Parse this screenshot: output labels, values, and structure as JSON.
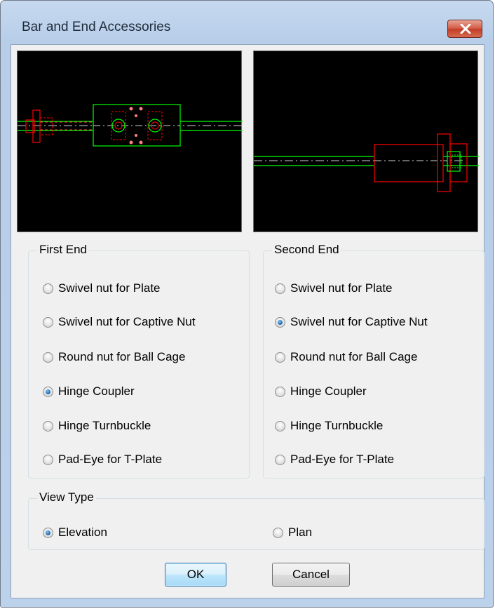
{
  "window": {
    "title": "Bar and End Accessories"
  },
  "first_end": {
    "legend": "First End",
    "options": [
      {
        "label": "Swivel nut for Plate",
        "checked": false
      },
      {
        "label": "Swivel nut for Captive Nut",
        "checked": false
      },
      {
        "label": "Round nut for Ball Cage",
        "checked": false
      },
      {
        "label": "Hinge Coupler",
        "checked": true
      },
      {
        "label": "Hinge Turnbuckle",
        "checked": false
      },
      {
        "label": "Pad-Eye for T-Plate",
        "checked": false
      }
    ]
  },
  "second_end": {
    "legend": "Second End",
    "options": [
      {
        "label": "Swivel nut for Plate",
        "checked": false
      },
      {
        "label": "Swivel nut for Captive Nut",
        "checked": true
      },
      {
        "label": "Round nut for Ball Cage",
        "checked": false
      },
      {
        "label": "Hinge Coupler",
        "checked": false
      },
      {
        "label": "Hinge Turnbuckle",
        "checked": false
      },
      {
        "label": "Pad-Eye for T-Plate",
        "checked": false
      }
    ]
  },
  "view_type": {
    "legend": "View Type",
    "options": [
      {
        "label": "Elevation",
        "checked": true
      },
      {
        "label": "Plan",
        "checked": false
      }
    ]
  },
  "buttons": {
    "ok": "OK",
    "cancel": "Cancel"
  },
  "colors": {
    "preview_bg": "#000000",
    "bar_green": "#00ff00",
    "fitting_red": "#ff0000",
    "centerline": "#ffffff"
  }
}
